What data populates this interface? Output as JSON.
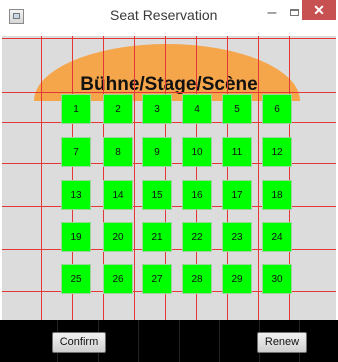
{
  "window": {
    "title": "Seat Reservation",
    "icons": [
      "app-icon",
      "minimize-icon",
      "maximize-icon",
      "close-icon"
    ],
    "min_glyph": "–",
    "close_glyph": "✕"
  },
  "stage": {
    "label": "Bühne/Stage/Scène"
  },
  "seats": {
    "rows": [
      [
        "1",
        "2",
        "3",
        "4",
        "5",
        "6"
      ],
      [
        "7",
        "8",
        "9",
        "10",
        "11",
        "12"
      ],
      [
        "13",
        "14",
        "15",
        "16",
        "17",
        "18"
      ],
      [
        "19",
        "20",
        "21",
        "22",
        "23",
        "24"
      ],
      [
        "25",
        "26",
        "27",
        "28",
        "29",
        "30"
      ]
    ],
    "available_color": "#00ff00"
  },
  "buttons": {
    "confirm_label": "Confirm",
    "renew_label": "Renew"
  },
  "colors": {
    "grid_line": "#e33838",
    "grid_background": "#dcdcdc",
    "stage": "#f5a54a",
    "bottom_bar": "#000000",
    "close_button": "#c75050"
  }
}
